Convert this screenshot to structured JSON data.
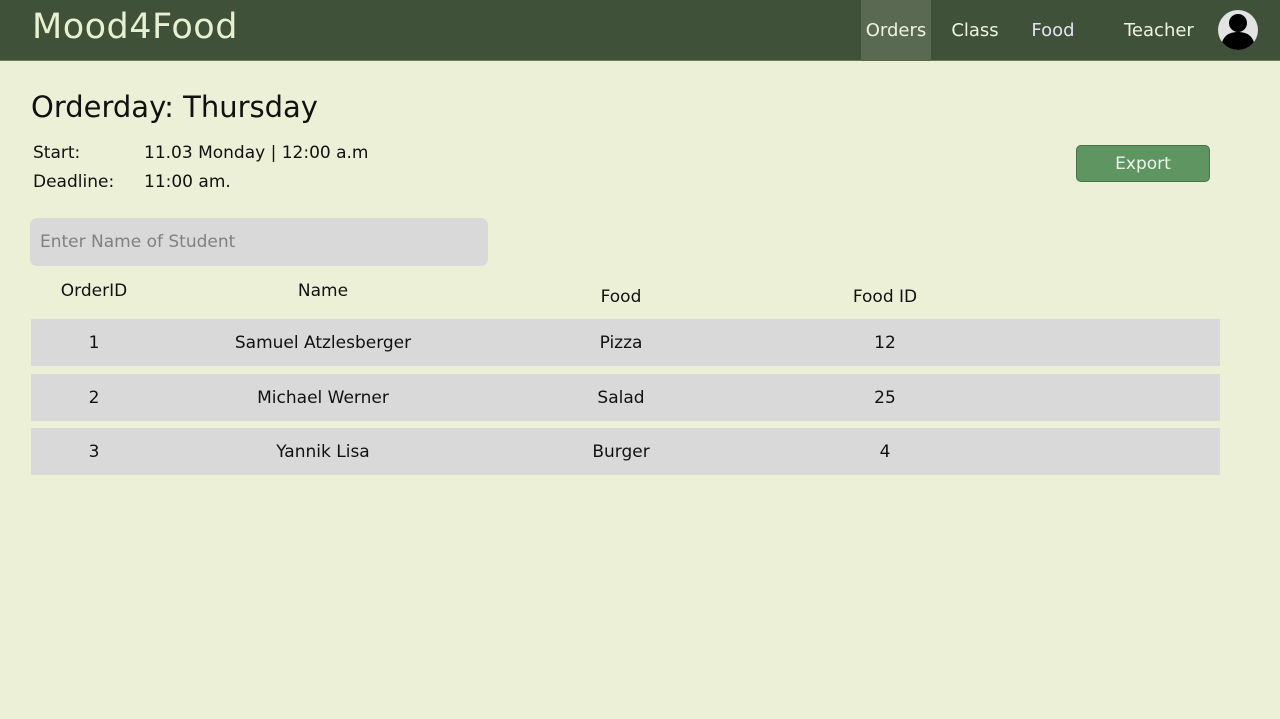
{
  "app": {
    "brand": "Mood4Food"
  },
  "nav": {
    "items": [
      {
        "label": "Orders",
        "active": true
      },
      {
        "label": "Class",
        "active": false
      },
      {
        "label": "Food",
        "active": false
      }
    ],
    "user_label": "Teacher",
    "avatar_icon": "user-icon"
  },
  "page": {
    "title": "Orderday: Thursday",
    "start_label": "Start:",
    "start_value": "11.03 Monday | 12:00 a.m",
    "deadline_label": "Deadline:",
    "deadline_value": "11:00 am.",
    "export_label": "Export"
  },
  "search": {
    "placeholder": "Enter Name of Student",
    "value": ""
  },
  "table": {
    "columns": [
      "OrderID",
      "Name",
      "Food",
      "Food ID"
    ],
    "rows": [
      {
        "order_id": "1",
        "name": "Samuel Atzlesberger",
        "food": "Pizza",
        "food_id": "12"
      },
      {
        "order_id": "2",
        "name": "Michael Werner",
        "food": "Salad",
        "food_id": "25"
      },
      {
        "order_id": "3",
        "name": "Yannik Lisa",
        "food": "Burger",
        "food_id": "4"
      }
    ]
  },
  "colors": {
    "navbar": "#40513a",
    "background": "#ecf0d7",
    "export_button": "#5e9560",
    "row_background": "#d9d9d9"
  }
}
